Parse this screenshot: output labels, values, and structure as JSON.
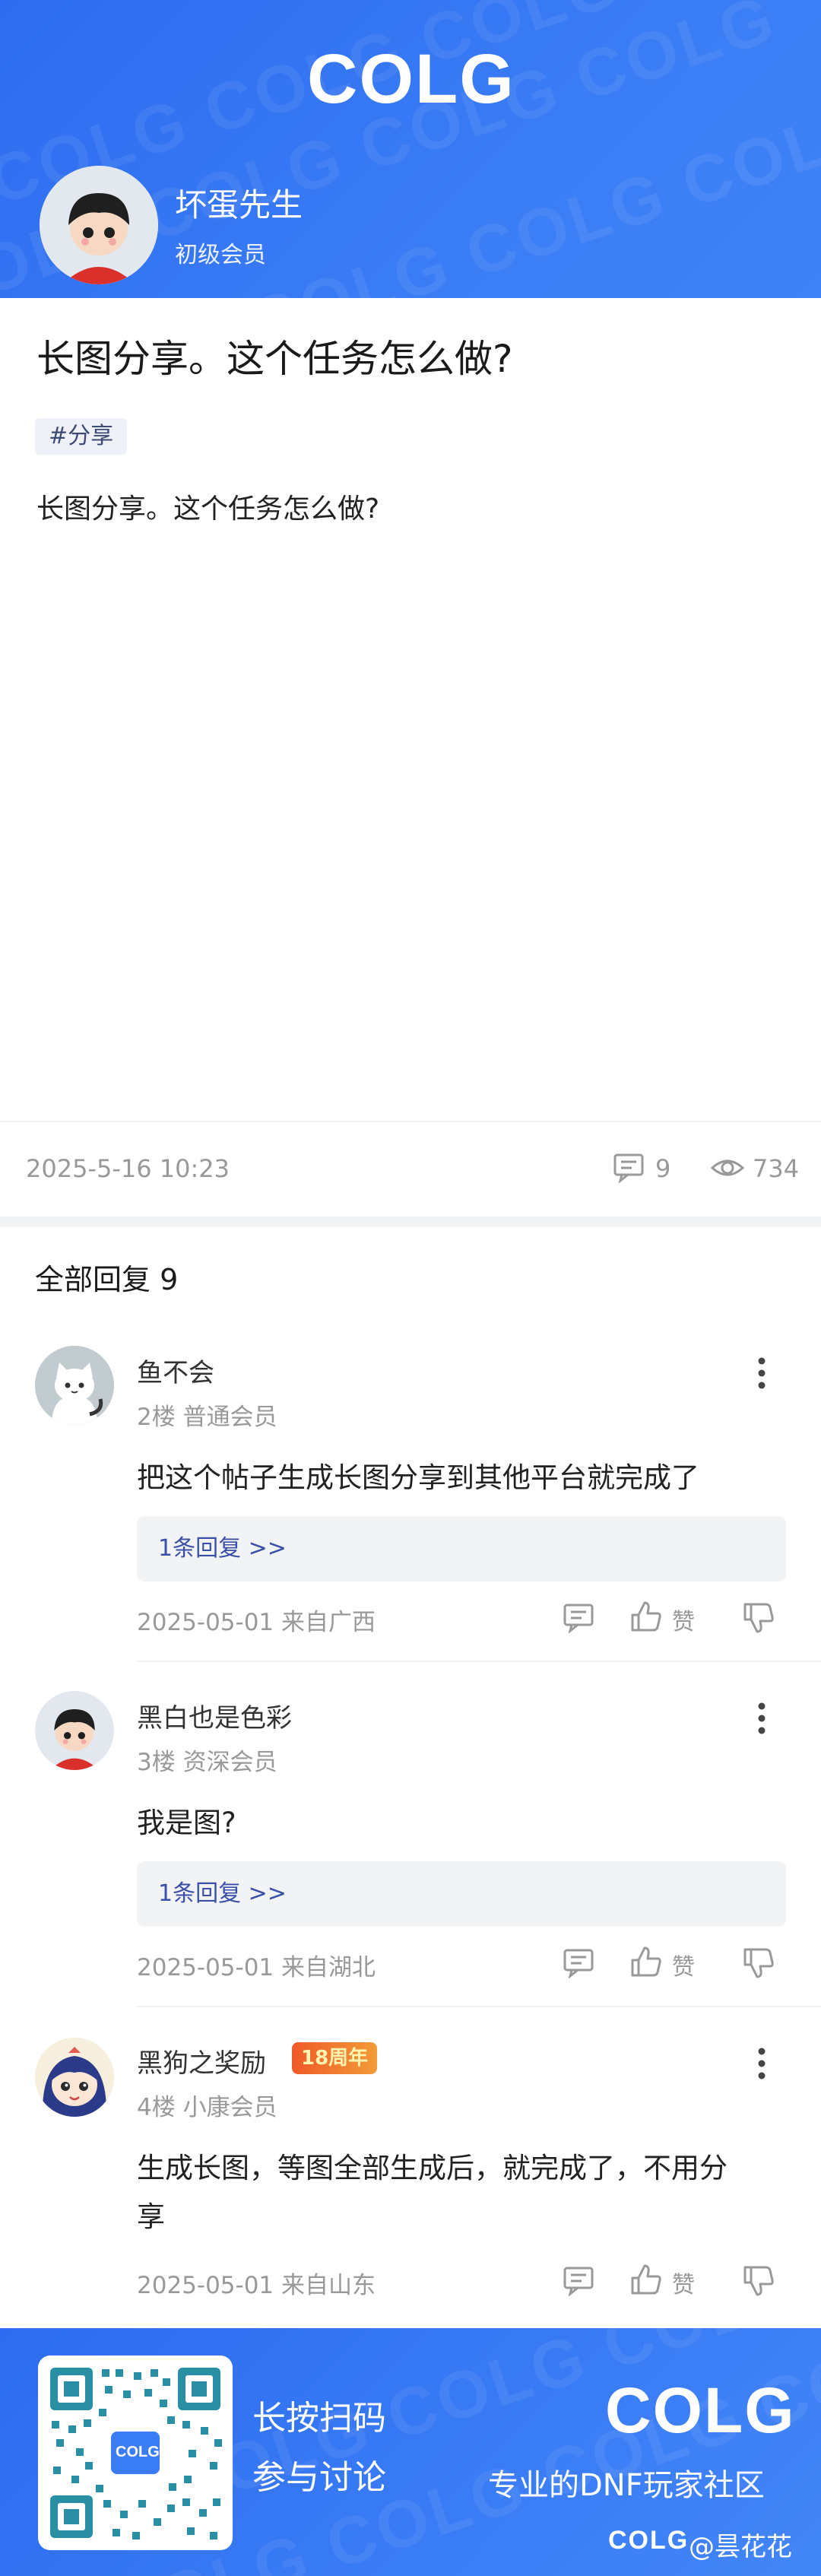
{
  "header": {
    "logo": "COLG",
    "user": {
      "name": "坏蛋先生",
      "level": "初级会员"
    }
  },
  "post": {
    "title": "长图分享。这个任务怎么做?",
    "tag": "#分享",
    "body": "长图分享。这个任务怎么做?",
    "date": "2025-5-16 10:23",
    "comments": "9",
    "views": "734"
  },
  "replies_section": {
    "heading": "全部回复  9",
    "items": [
      {
        "name": "鱼不会",
        "floor": "2楼 普通会员",
        "text": "把这个帖子生成长图分享到其他平台就完成了",
        "subreply": "1条回复 >>",
        "date": "2025-05-01 来自广西",
        "like": "赞"
      },
      {
        "name": "黑白也是色彩",
        "floor": "3楼 资深会员",
        "text": "我是图?",
        "subreply": "1条回复 >>",
        "date": "2025-05-01 来自湖北",
        "like": "赞"
      },
      {
        "name": "黑狗之奖励",
        "badge": "18周年",
        "floor": "4楼 小康会员",
        "text_line1": "生成长图，等图全部生成后，就完成了，不用分",
        "text_line2": "享",
        "date": "2025-05-01 来自山东",
        "like": "赞"
      }
    ]
  },
  "footer": {
    "qr_logo": "COLG",
    "cta_line1": "长按扫码",
    "cta_line2": "参与讨论",
    "logo": "COLG",
    "slogan": "专业的DNF玩家社区",
    "credit_logo": "COLG",
    "credit": "@昙花花"
  },
  "colors": {
    "brand_blue": "#3478f6",
    "tag_bg": "#eef1f8",
    "link_blue": "#3b4fa8",
    "badge_orange": "#f07a2a"
  }
}
